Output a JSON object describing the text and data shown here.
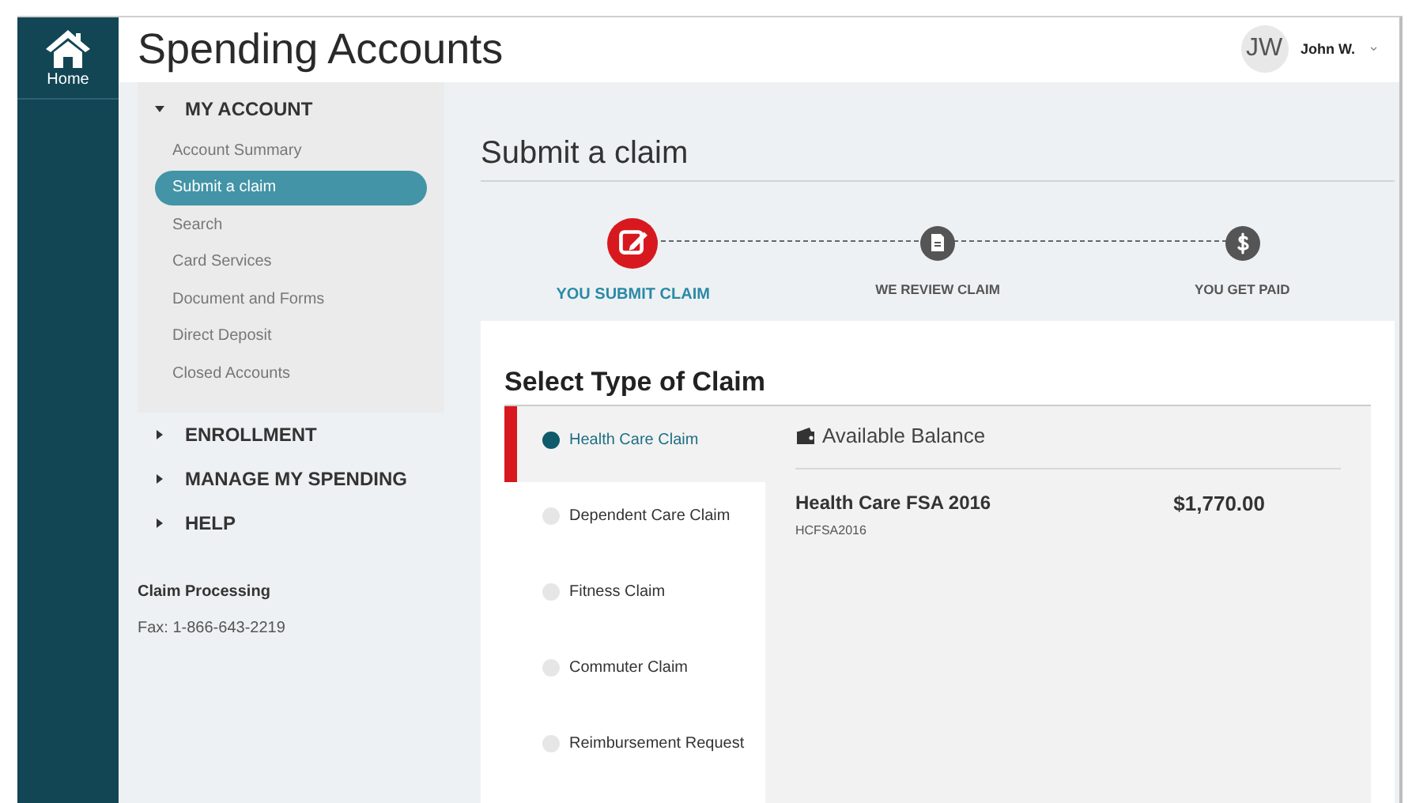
{
  "app": {
    "home_label": "Home",
    "title": "Spending Accounts"
  },
  "user": {
    "initials": "JW",
    "name": "John W.",
    "caret": "⌄"
  },
  "nav": [
    {
      "label": "MY ACCOUNT",
      "expanded": true,
      "items": [
        {
          "label": "Account Summary",
          "selected": false
        },
        {
          "label": "Submit a claim",
          "selected": true
        },
        {
          "label": "Search",
          "selected": false
        },
        {
          "label": "Card Services",
          "selected": false
        },
        {
          "label": "Document and Forms",
          "selected": false
        },
        {
          "label": "Direct Deposit",
          "selected": false
        },
        {
          "label": "Closed Accounts",
          "selected": false
        }
      ]
    },
    {
      "label": "ENROLLMENT",
      "expanded": false
    },
    {
      "label": "MANAGE MY SPENDING",
      "expanded": false
    },
    {
      "label": "HELP",
      "expanded": false
    }
  ],
  "contact": {
    "title": "Claim Processing",
    "fax": "Fax: 1-866-643-2219"
  },
  "page_title": "Submit a claim",
  "steps": [
    {
      "kind": "edit",
      "label": "YOU SUBMIT CLAIM",
      "selected": true
    },
    {
      "kind": "document",
      "label": "WE REVIEW CLAIM",
      "selected": false
    },
    {
      "kind": "dollar",
      "label": "YOU GET PAID",
      "selected": false
    }
  ],
  "claim_section_title": "Select Type of Claim",
  "claim_types": [
    {
      "label": "Health Care Claim",
      "selected": true
    },
    {
      "label": "Dependent Care Claim",
      "selected": false
    },
    {
      "label": "Fitness Claim",
      "selected": false
    },
    {
      "label": "Commuter Claim",
      "selected": false
    },
    {
      "label": "Reimbursement Request",
      "selected": false
    }
  ],
  "balance": {
    "title": "Available Balance",
    "accounts": [
      {
        "name": "Health Care FSA 2016",
        "code": "HCFSA2016",
        "amount": "$1,770.00"
      }
    ]
  }
}
